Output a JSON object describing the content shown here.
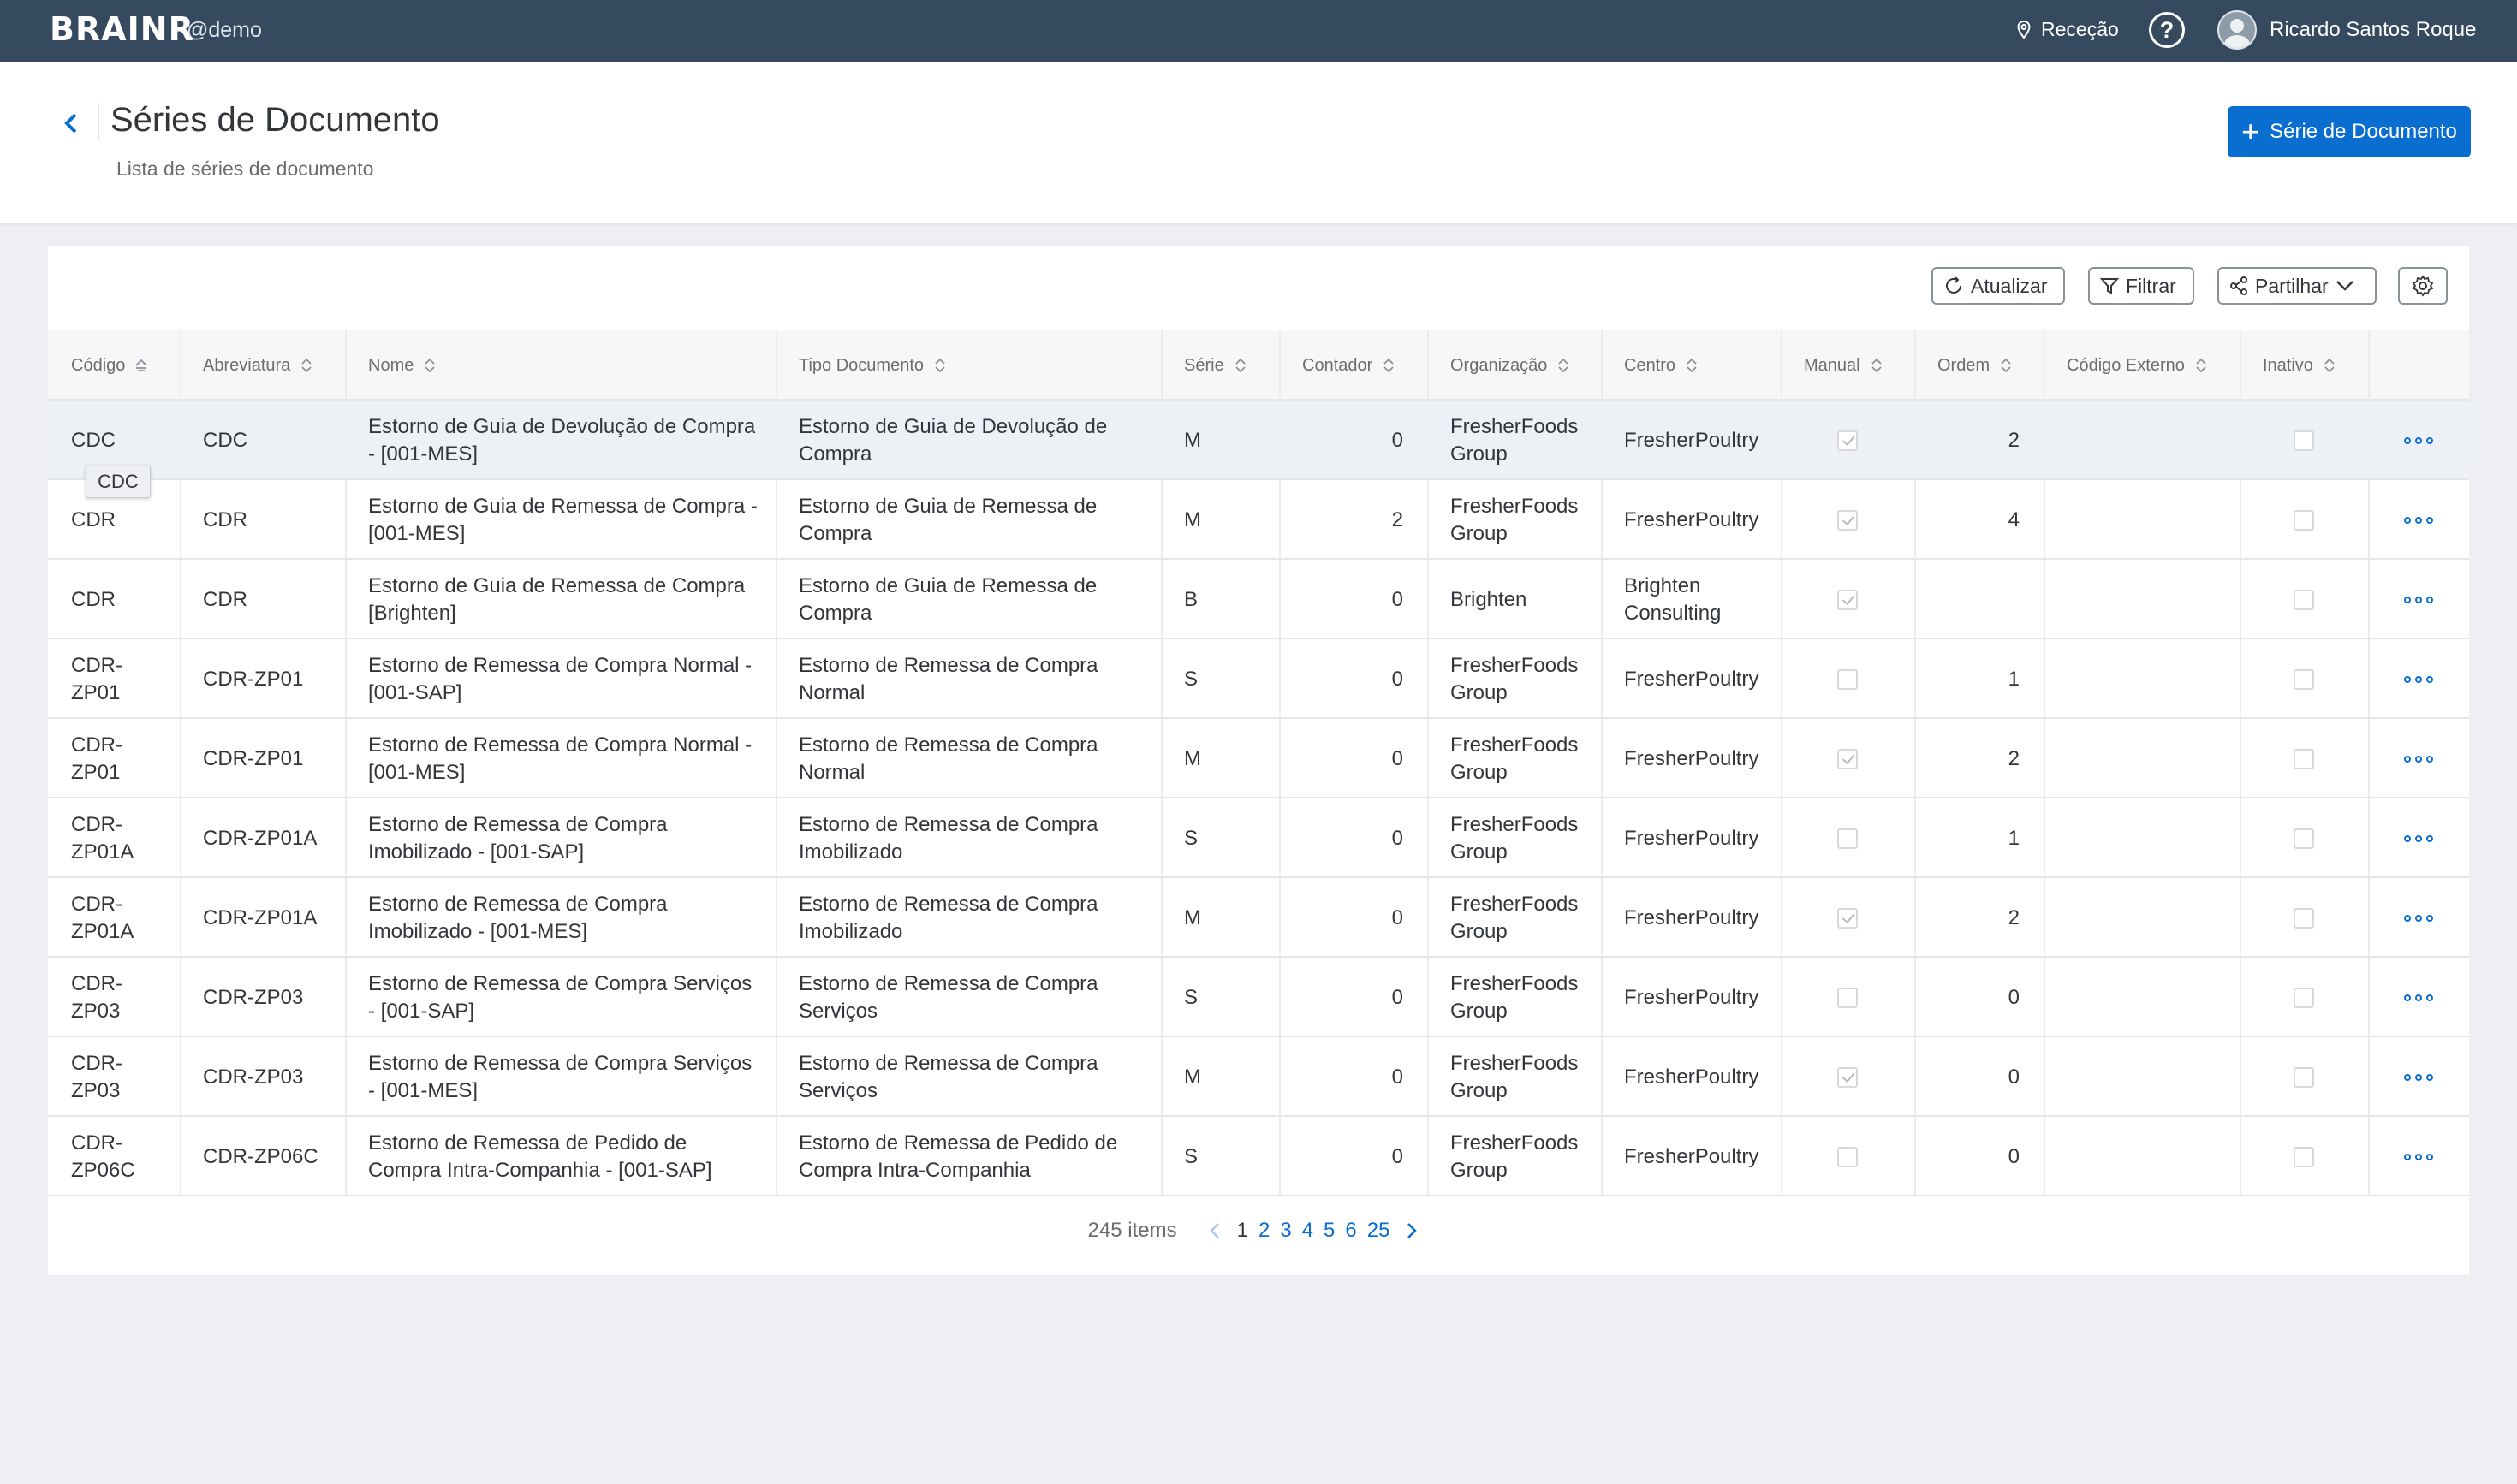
{
  "topbar": {
    "brand": "BRAINR",
    "brand_sub": "@demo",
    "location": "Receção",
    "user": "Ricardo Santos Roque"
  },
  "header": {
    "title": "Séries de Documento",
    "subtitle": "Lista de séries de documento",
    "add_label": "Série de Documento"
  },
  "toolbar": {
    "refresh": "Atualizar",
    "filter": "Filtrar",
    "share": "Partilhar"
  },
  "table": {
    "columns": [
      "Código",
      "Abreviatura",
      "Nome",
      "Tipo Documento",
      "Série",
      "Contador",
      "Organização",
      "Centro",
      "Manual",
      "Ordem",
      "Código Externo",
      "Inativo"
    ],
    "rows": [
      {
        "codigo": "CDC",
        "abrev": "CDC",
        "nome": "Estorno de Guia de Devolução de Compra - [001-MES]",
        "tipo": "Estorno de Guia de Devolução de Compra",
        "serie": "M",
        "contador": "0",
        "org": "FresherFoods Group",
        "centro": "FresherPoultry",
        "manual": true,
        "ordem": "2",
        "ext": "",
        "inativo": false
      },
      {
        "codigo": "CDR",
        "abrev": "CDR",
        "nome": "Estorno de Guia de Remessa de Compra - [001-MES]",
        "tipo": "Estorno de Guia de Remessa de Compra",
        "serie": "M",
        "contador": "2",
        "org": "FresherFoods Group",
        "centro": "FresherPoultry",
        "manual": true,
        "ordem": "4",
        "ext": "",
        "inativo": false
      },
      {
        "codigo": "CDR",
        "abrev": "CDR",
        "nome": "Estorno de Guia de Remessa de Compra [Brighten]",
        "tipo": "Estorno de Guia de Remessa de Compra",
        "serie": "B",
        "contador": "0",
        "org": "Brighten",
        "centro": "Brighten Consulting",
        "manual": true,
        "ordem": "",
        "ext": "",
        "inativo": false
      },
      {
        "codigo": "CDR-ZP01",
        "abrev": "CDR-ZP01",
        "nome": "Estorno de Remessa de Compra Normal - [001-SAP]",
        "tipo": "Estorno de Remessa de Compra Normal",
        "serie": "S",
        "contador": "0",
        "org": "FresherFoods Group",
        "centro": "FresherPoultry",
        "manual": false,
        "ordem": "1",
        "ext": "",
        "inativo": false
      },
      {
        "codigo": "CDR-ZP01",
        "abrev": "CDR-ZP01",
        "nome": "Estorno de Remessa de Compra Normal - [001-MES]",
        "tipo": "Estorno de Remessa de Compra Normal",
        "serie": "M",
        "contador": "0",
        "org": "FresherFoods Group",
        "centro": "FresherPoultry",
        "manual": true,
        "ordem": "2",
        "ext": "",
        "inativo": false
      },
      {
        "codigo": "CDR-ZP01A",
        "abrev": "CDR-ZP01A",
        "nome": "Estorno de Remessa de Compra Imobilizado - [001-SAP]",
        "tipo": "Estorno de Remessa de Compra Imobilizado",
        "serie": "S",
        "contador": "0",
        "org": "FresherFoods Group",
        "centro": "FresherPoultry",
        "manual": false,
        "ordem": "1",
        "ext": "",
        "inativo": false
      },
      {
        "codigo": "CDR-ZP01A",
        "abrev": "CDR-ZP01A",
        "nome": "Estorno de Remessa de Compra Imobilizado - [001-MES]",
        "tipo": "Estorno de Remessa de Compra Imobilizado",
        "serie": "M",
        "contador": "0",
        "org": "FresherFoods Group",
        "centro": "FresherPoultry",
        "manual": true,
        "ordem": "2",
        "ext": "",
        "inativo": false
      },
      {
        "codigo": "CDR-ZP03",
        "abrev": "CDR-ZP03",
        "nome": "Estorno de Remessa de Compra Serviços - [001-SAP]",
        "tipo": "Estorno de Remessa de Compra Serviços",
        "serie": "S",
        "contador": "0",
        "org": "FresherFoods Group",
        "centro": "FresherPoultry",
        "manual": false,
        "ordem": "0",
        "ext": "",
        "inativo": false
      },
      {
        "codigo": "CDR-ZP03",
        "abrev": "CDR-ZP03",
        "nome": "Estorno de Remessa de Compra Serviços - [001-MES]",
        "tipo": "Estorno de Remessa de Compra Serviços",
        "serie": "M",
        "contador": "0",
        "org": "FresherFoods Group",
        "centro": "FresherPoultry",
        "manual": true,
        "ordem": "0",
        "ext": "",
        "inativo": false
      },
      {
        "codigo": "CDR-ZP06C",
        "abrev": "CDR-ZP06C",
        "nome": "Estorno de Remessa de Pedido de Compra Intra-Companhia - [001-SAP]",
        "tipo": "Estorno de Remessa de Pedido de Compra Intra-Companhia",
        "serie": "S",
        "contador": "0",
        "org": "FresherFoods Group",
        "centro": "FresherPoultry",
        "manual": false,
        "ordem": "0",
        "ext": "",
        "inativo": false
      }
    ]
  },
  "tooltip": "CDC",
  "pagination": {
    "count": "245 items",
    "pages": [
      "1",
      "2",
      "3",
      "4",
      "5",
      "6",
      "25"
    ],
    "current": "1"
  }
}
